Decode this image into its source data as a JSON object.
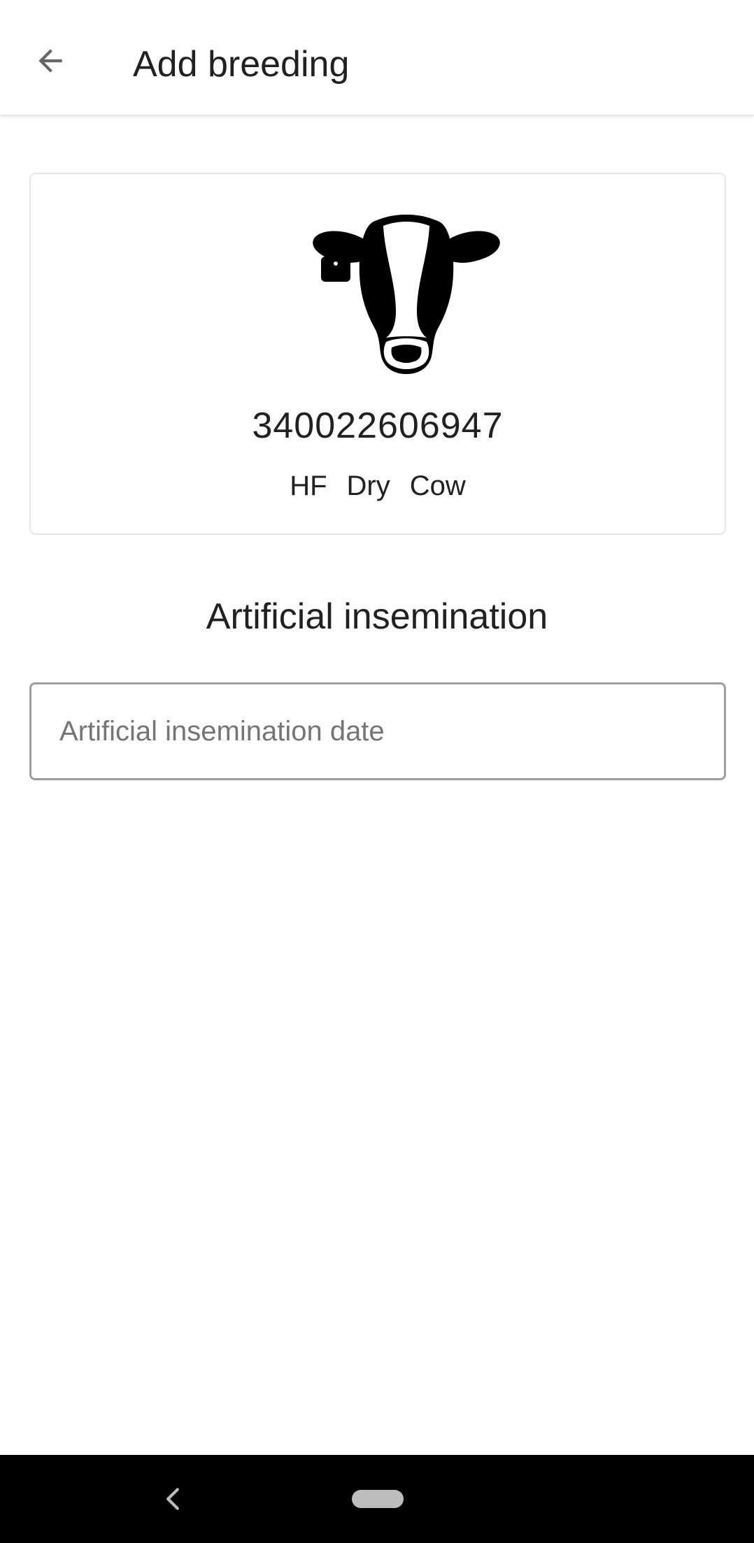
{
  "app_bar": {
    "back_icon": "arrow-back-icon",
    "title": "Add breeding"
  },
  "animal": {
    "icon": "cow-head-icon",
    "id": "340022606947",
    "tags": [
      "HF",
      "Dry",
      "Cow"
    ]
  },
  "section": {
    "title": "Artificial insemination"
  },
  "insemination_date": {
    "placeholder": "Artificial insemination date",
    "value": ""
  },
  "system_nav": {
    "back_icon": "nav-back-chevron-icon",
    "home_icon": "nav-home-pill-icon"
  },
  "colors": {
    "text_primary": "#212121",
    "placeholder": "#757575",
    "input_border": "#9e9e9e",
    "card_border": "#e6e6e6",
    "nav_bar_background": "#000000"
  }
}
